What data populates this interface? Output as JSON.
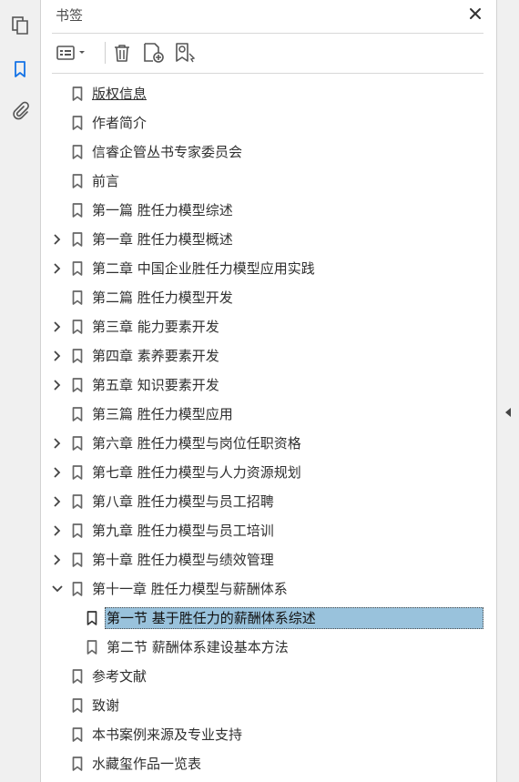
{
  "panel": {
    "title": "书签"
  },
  "tree": [
    {
      "label": "版权信息",
      "level": 0,
      "expand": "none",
      "underline": true
    },
    {
      "label": "作者简介",
      "level": 0,
      "expand": "none"
    },
    {
      "label": "信睿企管丛书专家委员会",
      "level": 0,
      "expand": "none"
    },
    {
      "label": "前言",
      "level": 0,
      "expand": "none"
    },
    {
      "label": "第一篇 胜任力模型综述",
      "level": 0,
      "expand": "none"
    },
    {
      "label": "第一章 胜任力模型概述",
      "level": 0,
      "expand": "collapsed"
    },
    {
      "label": "第二章 中国企业胜任力模型应用实践",
      "level": 0,
      "expand": "collapsed"
    },
    {
      "label": "第二篇 胜任力模型开发",
      "level": 0,
      "expand": "none"
    },
    {
      "label": "第三章 能力要素开发",
      "level": 0,
      "expand": "collapsed"
    },
    {
      "label": "第四章 素养要素开发",
      "level": 0,
      "expand": "collapsed"
    },
    {
      "label": "第五章 知识要素开发",
      "level": 0,
      "expand": "collapsed"
    },
    {
      "label": "第三篇 胜任力模型应用",
      "level": 0,
      "expand": "none"
    },
    {
      "label": "第六章 胜任力模型与岗位任职资格",
      "level": 0,
      "expand": "collapsed"
    },
    {
      "label": "第七章 胜任力模型与人力资源规划",
      "level": 0,
      "expand": "collapsed"
    },
    {
      "label": "第八章 胜任力模型与员工招聘",
      "level": 0,
      "expand": "collapsed"
    },
    {
      "label": "第九章 胜任力模型与员工培训",
      "level": 0,
      "expand": "collapsed"
    },
    {
      "label": "第十章 胜任力模型与绩效管理",
      "level": 0,
      "expand": "collapsed"
    },
    {
      "label": "第十一章 胜任力模型与薪酬体系",
      "level": 0,
      "expand": "expanded"
    },
    {
      "label": "第一节 基于胜任力的薪酬体系综述",
      "level": 1,
      "expand": "none",
      "selected": true
    },
    {
      "label": "第二节 薪酬体系建设基本方法",
      "level": 1,
      "expand": "none"
    },
    {
      "label": "参考文献",
      "level": 0,
      "expand": "none"
    },
    {
      "label": "致谢",
      "level": 0,
      "expand": "none"
    },
    {
      "label": "本书案例来源及专业支持",
      "level": 0,
      "expand": "none"
    },
    {
      "label": "水藏玺作品一览表",
      "level": 0,
      "expand": "none"
    }
  ],
  "colors": {
    "selection": "#99c2dc",
    "accent": "#1473e6",
    "icon": "#555555"
  },
  "icons": {
    "rail": [
      "pages-icon",
      "bookmark-icon",
      "paperclip-icon"
    ],
    "toolbar": [
      "options-list-icon",
      "trash-icon",
      "new-bookmark-icon",
      "bookmark-search-icon"
    ]
  }
}
